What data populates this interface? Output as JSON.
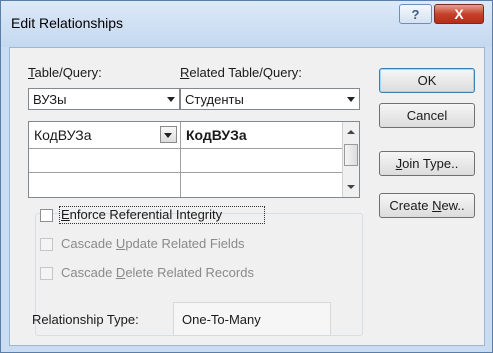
{
  "window": {
    "title": "Edit Relationships",
    "help_glyph": "?",
    "close_glyph": "X"
  },
  "table_query": {
    "label_accel": "T",
    "label_rest": "able/Query:",
    "value": "ВУЗы"
  },
  "related_table_query": {
    "label_accel": "R",
    "label_rest": "elated Table/Query:",
    "value": "Студенты"
  },
  "fields": {
    "rows": [
      {
        "left": "КодВУЗа",
        "right": "КодВУЗа"
      },
      {
        "left": "",
        "right": ""
      },
      {
        "left": "",
        "right": ""
      }
    ]
  },
  "buttons": {
    "ok": "OK",
    "cancel": "Cancel",
    "join_type": {
      "accel": "J",
      "rest": "oin Type.."
    },
    "create_new": {
      "before": "Create ",
      "accel": "N",
      "after": "ew.."
    }
  },
  "options": {
    "enforce": {
      "accel": "E",
      "rest": "nforce Referential Integrity",
      "checked": false
    },
    "cascade_update": {
      "before": "Cascade ",
      "accel": "U",
      "after": "pdate Related Fields",
      "checked": false,
      "enabled": false
    },
    "cascade_delete": {
      "before": "Cascade ",
      "accel": "D",
      "after": "elete Related Records",
      "checked": false,
      "enabled": false
    }
  },
  "relationship": {
    "label": "Relationship Type:",
    "value": "One-To-Many"
  }
}
